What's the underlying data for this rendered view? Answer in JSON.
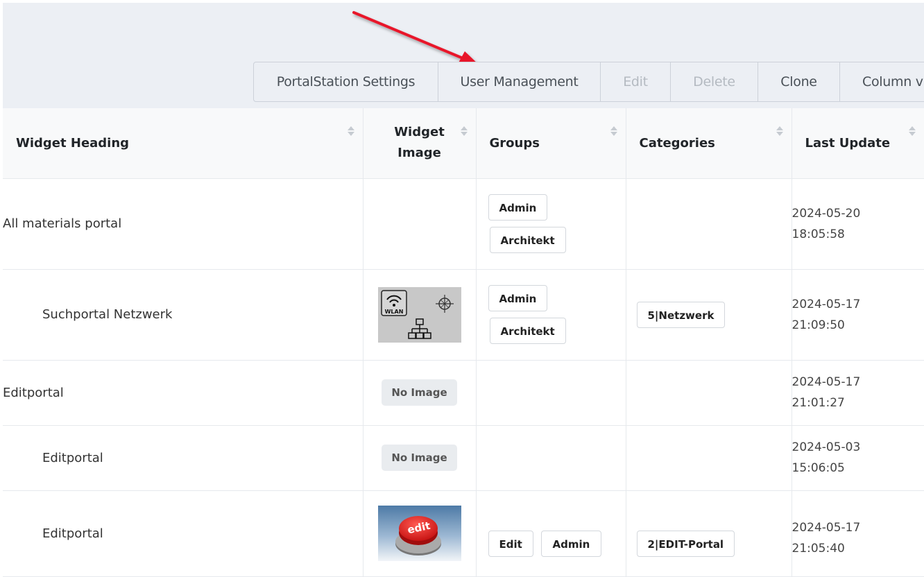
{
  "toolbar": {
    "buttons": [
      {
        "label": "PortalStation Settings",
        "disabled": false
      },
      {
        "label": "User Management",
        "disabled": false
      },
      {
        "label": "Edit",
        "disabled": true
      },
      {
        "label": "Delete",
        "disabled": true
      },
      {
        "label": "Clone",
        "disabled": false
      },
      {
        "label": "Column v",
        "disabled": false
      }
    ]
  },
  "table": {
    "headers": {
      "widget_heading": "Widget Heading",
      "widget_image": "Widget Image",
      "groups": "Groups",
      "categories": "Categories",
      "last_update": "Last Update"
    },
    "rows": [
      {
        "heading": "All materials portal",
        "image": "",
        "groups": [
          "Admin",
          "Architekt"
        ],
        "category": "",
        "date": "2024-05-20",
        "time": "18:05:58"
      },
      {
        "heading": "Suchportal Netzwerk",
        "image": "network-image",
        "groups": [
          "Admin",
          "Architekt"
        ],
        "category": "5|Netzwerk",
        "date": "2024-05-17",
        "time": "21:09:50"
      },
      {
        "heading": "Editportal",
        "image": "No Image",
        "groups": [],
        "category": "",
        "date": "2024-05-17",
        "time": "21:01:27"
      },
      {
        "heading": "Editportal",
        "image": "No Image",
        "groups": [],
        "category": "",
        "date": "2024-05-03",
        "time": "15:06:05"
      },
      {
        "heading": "Editportal",
        "image": "edit-button-image",
        "groups": [
          "Edit",
          "Admin"
        ],
        "category": "2|EDIT-Portal",
        "date": "2024-05-17",
        "time": "21:05:40"
      }
    ]
  },
  "images": {
    "wlan_label": "WLAN",
    "edit_label": "edit"
  },
  "colors": {
    "annotation_arrow": "#e8192c",
    "toolbar_bg": "#eceff4"
  }
}
